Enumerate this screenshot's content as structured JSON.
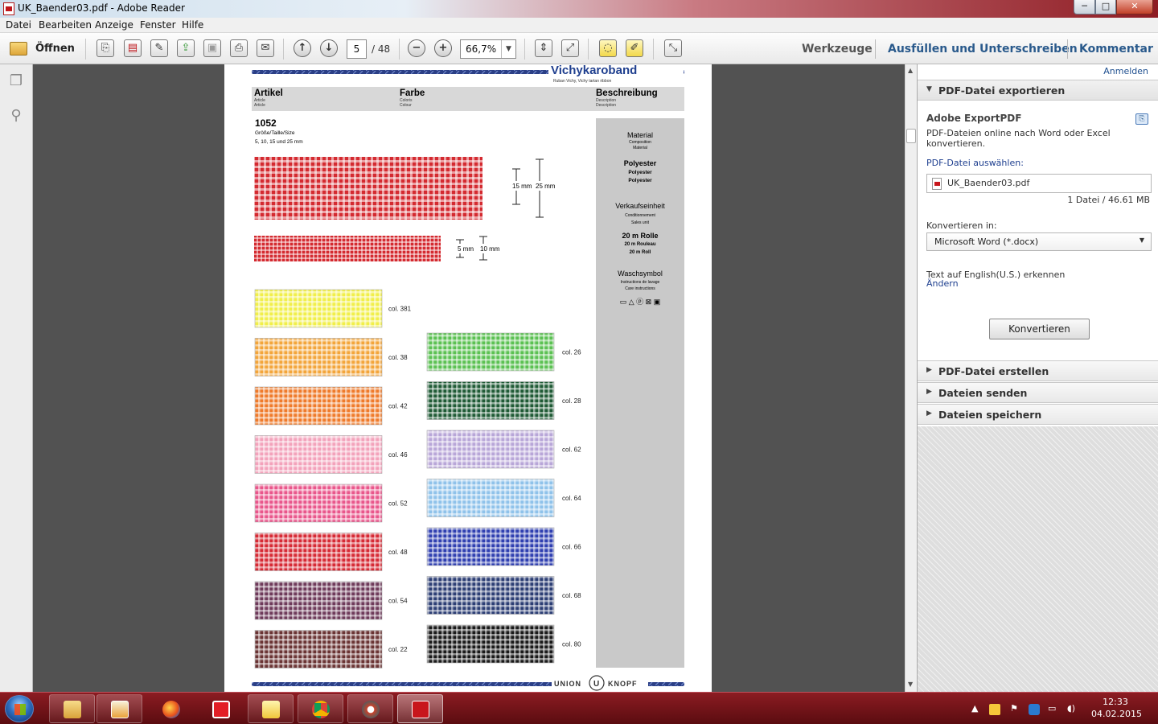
{
  "window": {
    "title": "UK_Baender03.pdf - Adobe Reader",
    "min": "─",
    "max": "□",
    "close": "✕"
  },
  "menu": [
    "Datei",
    "Bearbeiten",
    "Anzeige",
    "Fenster",
    "Hilfe"
  ],
  "toolbar": {
    "open_label": "Öffnen",
    "page_current": "5",
    "page_total": "/ 48",
    "zoom": "66,7%",
    "werkzeuge": "Werkzeuge",
    "ausfuellen": "Ausfüllen und Unterschreiben",
    "kommentar": "Kommentar"
  },
  "doc": {
    "brand_title": "Vichykaroband",
    "brand_sub": "Ruban Vichy, Vichy tartan ribbon",
    "header": {
      "artikel": "Artikel",
      "artikel_sub1": "Article",
      "artikel_sub2": "Article",
      "farbe": "Farbe",
      "farbe_sub1": "Coloris",
      "farbe_sub2": "Colour",
      "beschreibung": "Beschreibung",
      "beschreibung_sub1": "Description",
      "beschreibung_sub2": "Description"
    },
    "item_number": "1052",
    "size_label": "Größe/Taille/Size",
    "sizes": "5, 10, 15 und 25 mm",
    "dim_15": "15 mm",
    "dim_25": "25 mm",
    "dim_5": "5 mm",
    "dim_10": "10 mm",
    "desc": {
      "material": "Material",
      "material_sub1": "Composition",
      "material_sub2": "Material",
      "poly1": "Polyester",
      "poly2": "Polyester",
      "poly3": "Polyester",
      "vk": "Verkaufseinheit",
      "vk_sub1": "Conditionnement",
      "vk_sub2": "Sales unit",
      "rolle1": "20 m Rolle",
      "rolle2": "20 m Rouleau",
      "rolle3": "20 m Roll",
      "wasch": "Waschsymbol",
      "wasch_sub1": "Instructions de lavage",
      "wasch_sub2": "Care instructions",
      "care_symbols": "▭ △ ⓟ ⊠ ▣"
    },
    "swatches_left": [
      {
        "label": "col. 381",
        "color": "#f1ef4a",
        "line": "#ffffff"
      },
      {
        "label": "col. 38",
        "color": "#f3a53a",
        "line": "#ffffff"
      },
      {
        "label": "col. 42",
        "color": "#ef7a2a",
        "line": "#ffffff"
      },
      {
        "label": "col. 46",
        "color": "#f3a2bb",
        "line": "#ffffff"
      },
      {
        "label": "col. 52",
        "color": "#e9568b",
        "line": "#ffffff"
      },
      {
        "label": "col. 48",
        "color": "#d62a35",
        "line": "#ffffff"
      },
      {
        "label": "col. 54",
        "color": "#6e3a5a",
        "line": "#ffffff"
      },
      {
        "label": "col. 22",
        "color": "#6a3434",
        "line": "#ffffff"
      }
    ],
    "swatches_right": [
      {
        "label": "col. 26",
        "color": "#5bc152",
        "line": "#ffffff"
      },
      {
        "label": "col. 28",
        "color": "#1f5a35",
        "line": "#ffffff"
      },
      {
        "label": "col. 62",
        "color": "#b8a6d8",
        "line": "#ffffff"
      },
      {
        "label": "col. 64",
        "color": "#8fc2ea",
        "line": "#ffffff"
      },
      {
        "label": "col. 66",
        "color": "#2f3fb0",
        "line": "#ffffff"
      },
      {
        "label": "col. 68",
        "color": "#2c3e74",
        "line": "#ffffff"
      },
      {
        "label": "col. 80",
        "color": "#1a1a1a",
        "line": "#ffffff"
      }
    ],
    "footer_logo_left": "UNION",
    "footer_logo_right": "KNOPF",
    "footer_logo_mark": "U"
  },
  "rightpane": {
    "anmelden": "Anmelden",
    "export_title": "PDF-Datei exportieren",
    "product": "Adobe ExportPDF",
    "description": "PDF-Dateien online nach Word oder Excel konvertieren.",
    "select_label": "PDF-Datei auswählen:",
    "filename": "UK_Baender03.pdf",
    "fileinfo": "1 Datei / 46.61 MB",
    "convert_label": "Konvertieren in:",
    "convert_value": "Microsoft Word (*.docx)",
    "ocr": "Text auf English(U.S.) erkennen",
    "change": "Ändern",
    "convert_button": "Konvertieren",
    "sections": [
      "PDF-Datei erstellen",
      "Dateien senden",
      "Dateien speichern"
    ]
  },
  "taskbar": {
    "time": "12:33",
    "date": "04.02.2015"
  },
  "colors": {
    "accent": "#2a5a8c",
    "brand": "#1f3f8f",
    "header_gray": "#d8d8d8",
    "desc_gray": "#c9c9c9"
  }
}
